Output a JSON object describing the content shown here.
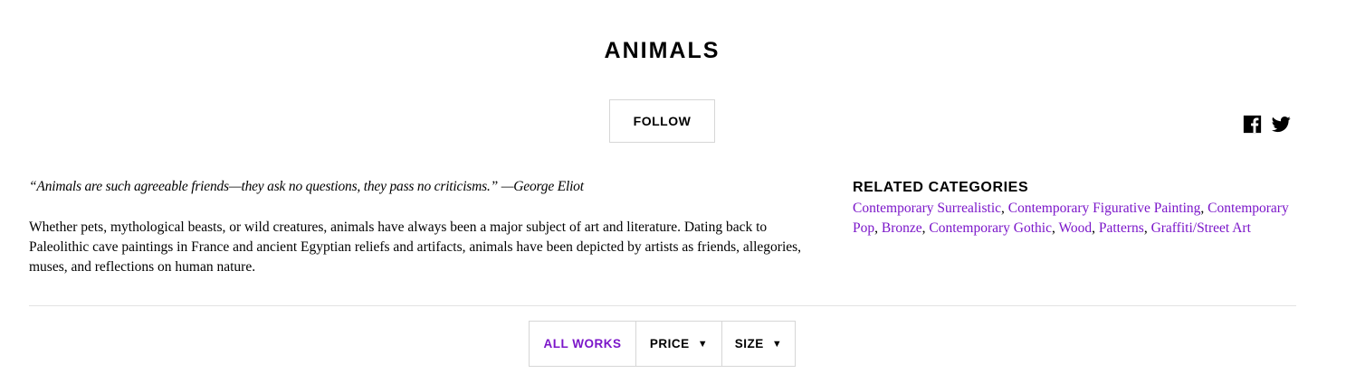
{
  "header": {
    "title": "ANIMALS",
    "follow_label": "FOLLOW"
  },
  "social": {
    "icons": [
      "facebook-icon",
      "twitter-icon"
    ]
  },
  "intro": {
    "quote": "“Animals are such agreeable friends—they ask no questions, they pass no criticisms.” —George Eliot",
    "description": "Whether pets, mythological beasts, or wild creatures, animals have always been a major subject of art and literature. Dating back to Paleolithic cave paintings in France and ancient Egyptian reliefs and artifacts, animals have been depicted by artists as friends, allegories, muses, and reflections on human nature."
  },
  "related": {
    "heading": "RELATED CATEGORIES",
    "links": [
      "Contemporary Surrealistic",
      "Contemporary Figurative Painting",
      "Contemporary Pop",
      "Bronze",
      "Contemporary Gothic",
      "Wood",
      "Patterns",
      "Graffiti/Street Art"
    ]
  },
  "filters": {
    "all_works": "ALL WORKS",
    "price": "PRICE",
    "size": "SIZE",
    "caret": "▼"
  },
  "colors": {
    "accent": "#7b16c9",
    "border": "#d6d6d6"
  }
}
